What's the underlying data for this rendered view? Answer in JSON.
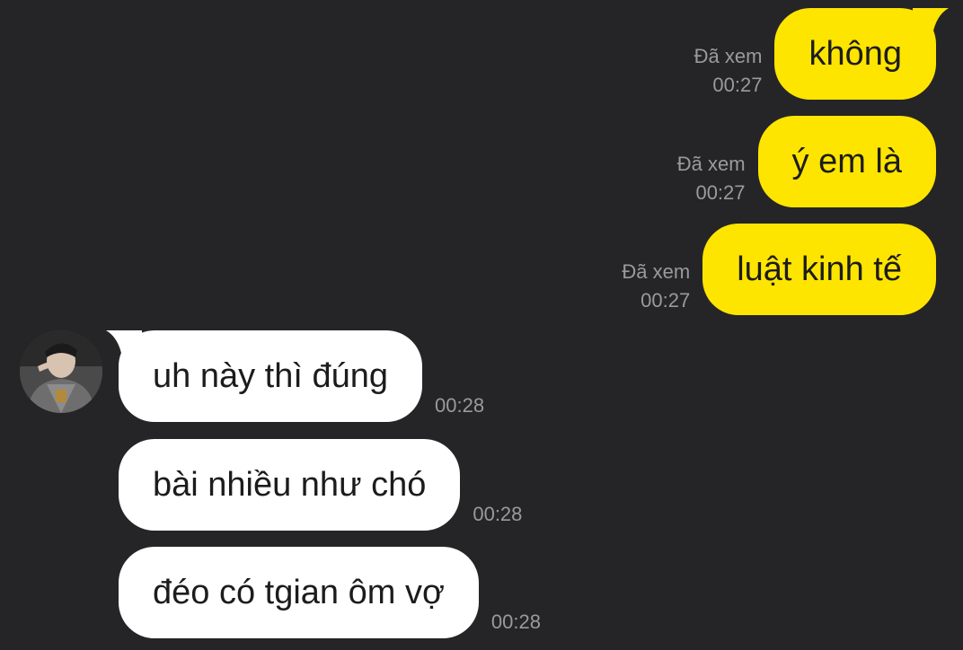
{
  "conversation": {
    "outgoing": [
      {
        "text": "không",
        "read_label": "Đã xem",
        "time": "00:27"
      },
      {
        "text": "ý em là",
        "read_label": "Đã xem",
        "time": "00:27"
      },
      {
        "text": "luật kinh tế",
        "read_label": "Đã xem",
        "time": "00:27"
      }
    ],
    "incoming": [
      {
        "text": "uh này thì đúng",
        "time": "00:28"
      },
      {
        "text": "bài nhiều như chó",
        "time": "00:28"
      },
      {
        "text": "đéo có tgian ôm vợ",
        "time": "00:28"
      }
    ]
  },
  "colors": {
    "background": "#252527",
    "outgoing_bubble": "#fee500",
    "incoming_bubble": "#ffffff",
    "meta_text": "#9a9a9c"
  },
  "icons": {
    "contact_avatar": "avatar-photo"
  }
}
